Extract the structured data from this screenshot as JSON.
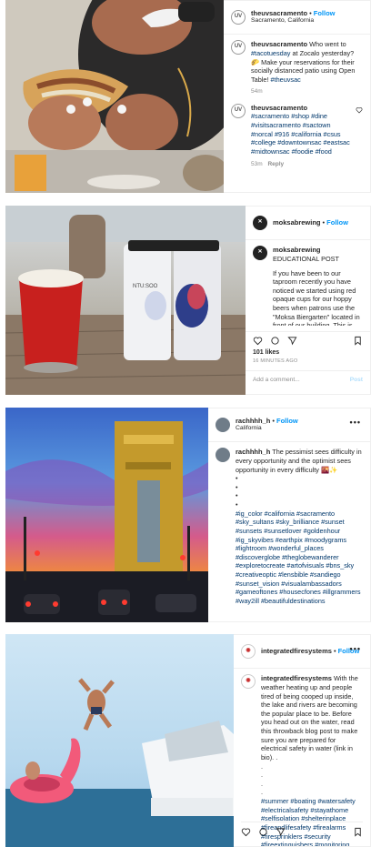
{
  "posts": [
    {
      "avatar_text": "UV",
      "username": "theuvsacramento",
      "follow": "Follow",
      "location": "Sacramento, California",
      "caption_user": "theuvsacramento",
      "caption": "Who went to",
      "caption_tag1": "#tacotuesday",
      "caption_rest": "at Zocalo yesterday? 🌮 Make your reservations for their socially distanced patio using Open Table!",
      "caption_tag2": "#theuvsac",
      "caption_age": "54m",
      "comment_user": "theuvsacramento",
      "comment_tags": "#sacramento #shop #dine #visitsacramento #sactown #norcal #916 #california #csus #college #downtownsac #eastsac #midtownsac #foodie #food",
      "comment_age": "53m",
      "reply": "Reply"
    },
    {
      "username": "moksabrewing",
      "follow": "Follow",
      "caption_user": "moksabrewing",
      "caption": "EDUCATIONAL POST",
      "body": "If you have been to our taproom recently you have noticed we started using red opaque cups for our hoppy beers when patrons use the \"Moksa Biergarten\" located in front of our building. This is not to create a party atmosphere or to prevent any glassware breakage but to protect the quality of our",
      "likes": "101 likes",
      "ago": "16 MINUTES AGO",
      "add_comment": "Add a comment...",
      "post": "Post",
      "can_label": "NTU:SOO"
    },
    {
      "username": "rachhhh_h",
      "follow": "Follow",
      "location": "California",
      "caption_user": "rachhhh_h",
      "caption": "The pessimist sees difficulty in every opportunity and the optimist sees opportunity in every difficulty 🌇✨",
      "bullets": [
        "•",
        "•",
        "•",
        "•"
      ],
      "tags": "#ig_color #california #sacramento #sky_sultans #sky_brilliance #sunset #sunsets #sunsetlover #goldenhour #ig_skyvibes #earthpix #moodygrams #lightroom #wonderful_places #discoverglobe #theglobewanderer #exploretocreate #artofvisuals #bns_sky #creativeoptic #lensbible #sandiego #sunset_vision #visualambassadors #gameoftones #housecfones #illgrammers #way2ill #beautifuldestinations"
    },
    {
      "username": "integratedfiresystems",
      "follow": "Follow",
      "caption_user": "integratedfiresystems",
      "caption": "With the weather heating up and people tired of being cooped up inside, the lake and rivers are becoming the popular place to be. Before you head out on the water, read this throwback blog post to make sure you are prepared for electrical safety in water (link in bio). .",
      "bullets": [
        ".",
        ".",
        ".",
        "."
      ],
      "tags": "#summer #boating #watersafety #electricalsafety #stayathome #selfisolation #shelterinplace #fireandlifesafety #firealarms #firesprinklers #security #fireextinguishers #monitoring"
    }
  ]
}
